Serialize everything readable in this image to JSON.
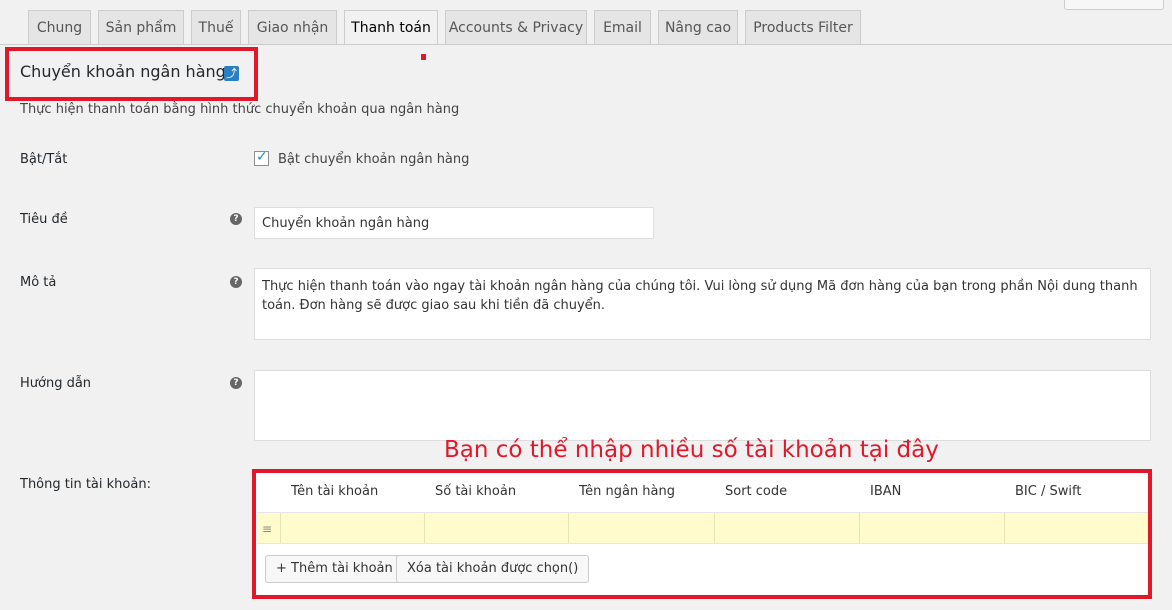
{
  "tabs": [
    "Chung",
    "Sản phẩm",
    "Thuế",
    "Giao nhận",
    "Thanh toán",
    "Accounts & Privacy",
    "Email",
    "Nâng cao",
    "Products Filter"
  ],
  "active_tab": "Thanh toán",
  "section": {
    "title": "Chuyển khoản ngân hàng",
    "up_icon": "⤴",
    "description": "Thực hiện thanh toán bằng hình thức chuyển khoản qua ngân hàng"
  },
  "fields": {
    "enable_label": "Bật/Tắt",
    "enable_checkbox_label": "Bật chuyển khoản ngân hàng",
    "title_label": "Tiêu đề",
    "title_value": "Chuyển khoản ngân hàng",
    "desc_label": "Mô tả",
    "desc_value": "Thực hiện thanh toán vào ngay tài khoản ngân hàng của chúng tôi. Vui lòng sử dụng Mã đơn hàng của bạn trong phần Nội dung thanh toán. Đơn hàng sẽ được giao sau khi tiền đã chuyển.",
    "instructions_label": "Hướng dẫn",
    "instructions_value": "",
    "accounts_label": "Thông tin tài khoản:"
  },
  "help_icon": "?",
  "annotation": "Bạn có thể nhập nhiều số tài khoản tại đây",
  "accounts_table": {
    "headers": [
      "Tên tài khoản",
      "Số tài khoản",
      "Tên ngân hàng",
      "Sort code",
      "IBAN",
      "BIC / Swift"
    ],
    "handle_icon": "≡",
    "add_button": "+ Thêm tài khoản",
    "remove_button": "Xóa tài khoản được chọn()"
  },
  "colors": {
    "highlight": "#e0182a",
    "row": "#fffbcc",
    "icon": "#2a7fc3"
  }
}
